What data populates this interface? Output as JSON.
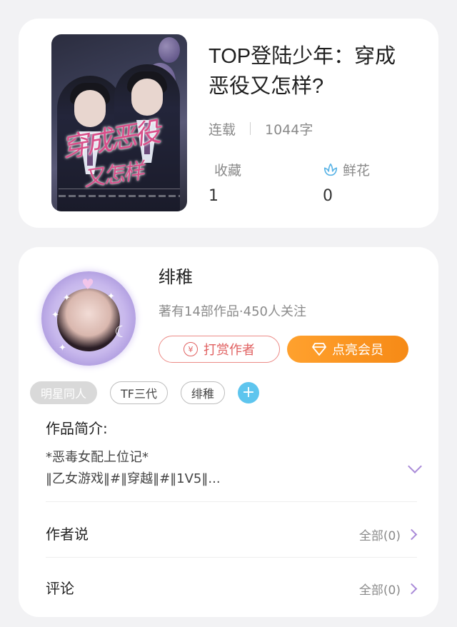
{
  "book": {
    "title": "TOP登陆少年：穿成恶役又怎样?",
    "status": "连载",
    "word_count": "1044字",
    "stats": [
      {
        "label": "收藏",
        "value": "1",
        "icon": ""
      },
      {
        "label": "鲜花",
        "value": "0",
        "icon": "flower-icon"
      }
    ]
  },
  "author": {
    "name": "绯稚",
    "info": "著有14部作品·450人关注",
    "reward_label": "打赏作者",
    "reward_icon": "¥",
    "vip_label": "点亮会员",
    "tags": [
      "明星同人",
      "TF三代",
      "绯稚"
    ]
  },
  "intro": {
    "title": "作品简介:",
    "line1": "*恶毒女配上位记*",
    "line2": "‖乙女游戏‖#‖穿越‖#‖1V5‖..."
  },
  "rows": [
    {
      "title": "作者说",
      "right": "全部(0)"
    },
    {
      "title": "评论",
      "right": "全部(0)"
    }
  ],
  "colors": {
    "accent_purple": "#a98ad8",
    "vip_orange": "#f68a16",
    "reward_red": "#e06060",
    "tag_add_blue": "#5ec5ee"
  }
}
